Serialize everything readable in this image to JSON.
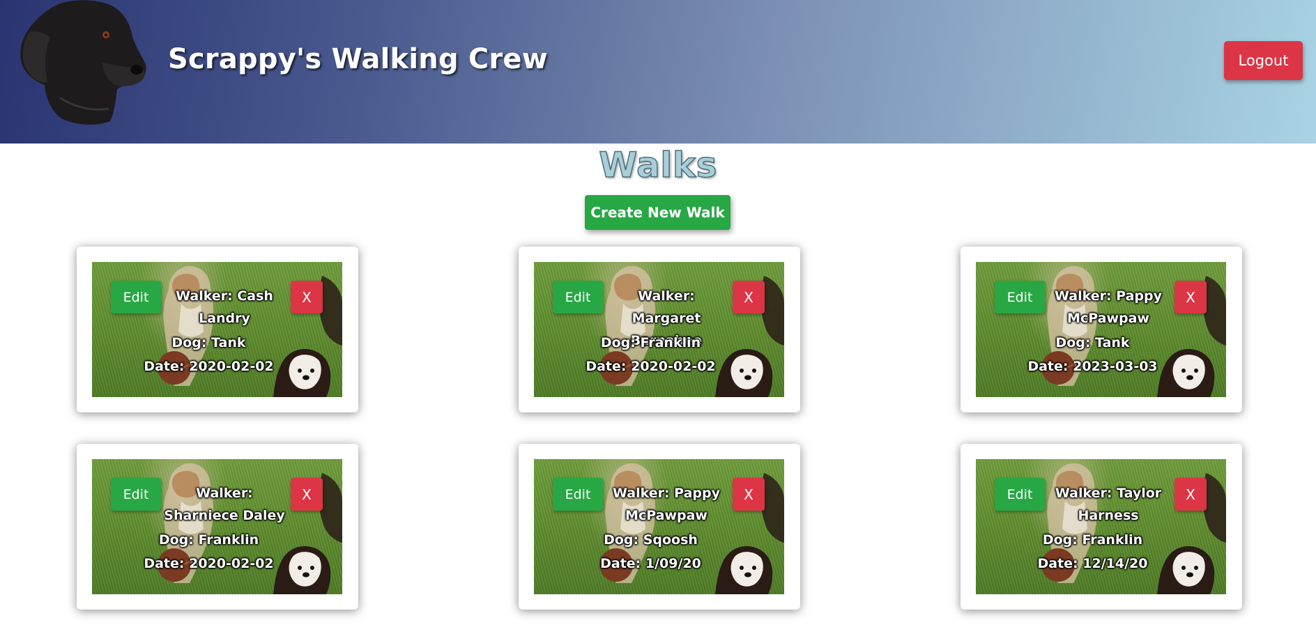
{
  "header": {
    "title": "Scrappy's Walking Crew",
    "logout_label": "Logout"
  },
  "main": {
    "title": "Walks",
    "create_label": "Create New Walk"
  },
  "walks": [
    {
      "walker": "Walker: Cash Landry",
      "dog": "Dog: Tank",
      "date": "Date: 2020-02-02",
      "edit_label": "Edit",
      "delete_label": "X"
    },
    {
      "walker": "Walker: Margaret Barnabee",
      "dog": "Dog: Franklin",
      "date": "Date: 2020-02-02",
      "edit_label": "Edit",
      "delete_label": "X"
    },
    {
      "walker": "Walker: Pappy McPawpaw",
      "dog": "Dog: Tank",
      "date": "Date: 2023-03-03",
      "edit_label": "Edit",
      "delete_label": "X"
    },
    {
      "walker": "Walker: Sharniece Daley",
      "dog": "Dog: Franklin",
      "date": "Date: 2020-02-02",
      "edit_label": "Edit",
      "delete_label": "X"
    },
    {
      "walker": "Walker: Pappy McPawpaw",
      "dog": "Dog: Sqoosh",
      "date": "Date: 1/09/20",
      "edit_label": "Edit",
      "delete_label": "X"
    },
    {
      "walker": "Walker: Taylor Harness",
      "dog": "Dog: Franklin",
      "date": "Date: 12/14/20",
      "edit_label": "Edit",
      "delete_label": "X"
    }
  ],
  "colors": {
    "success": "#28a745",
    "danger": "#dc3545",
    "title_fill": "#a9cdd9"
  },
  "icons": {
    "logo": "black-labrador-logo-icon",
    "card_image": "dogs-on-grass-photo"
  }
}
